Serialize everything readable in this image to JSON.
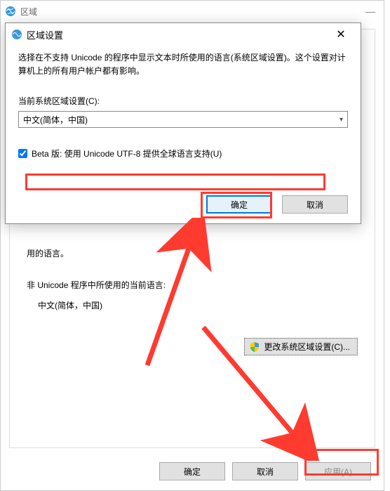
{
  "parent": {
    "title": "区域",
    "tab_text_fragment": "用的语言。",
    "non_unicode_label": "非 Unicode 程序中所使用的当前语言:",
    "current_locale": "中文(简体，中国)",
    "change_locale_button": "更改系统区域设置(C)...",
    "ok": "确定",
    "cancel": "取消",
    "apply": "应用(A)"
  },
  "modal": {
    "title": "区域设置",
    "description": "选择在不支持 Unicode 的程序中显示文本时所使用的语言(系统区域设置)。这个设置对计算机上的所有用户帐户都有影响。",
    "current_locale_label": "当前系统区域设置(C):",
    "locale_value": "中文(简体，中国)",
    "beta_checkbox": "Beta 版: 使用 Unicode UTF-8 提供全球语言支持(U)",
    "ok": "确定",
    "cancel": "取消"
  },
  "annotations": {
    "highlight_beta": true,
    "highlight_ok": true,
    "highlight_apply": true,
    "arrows": 2
  }
}
